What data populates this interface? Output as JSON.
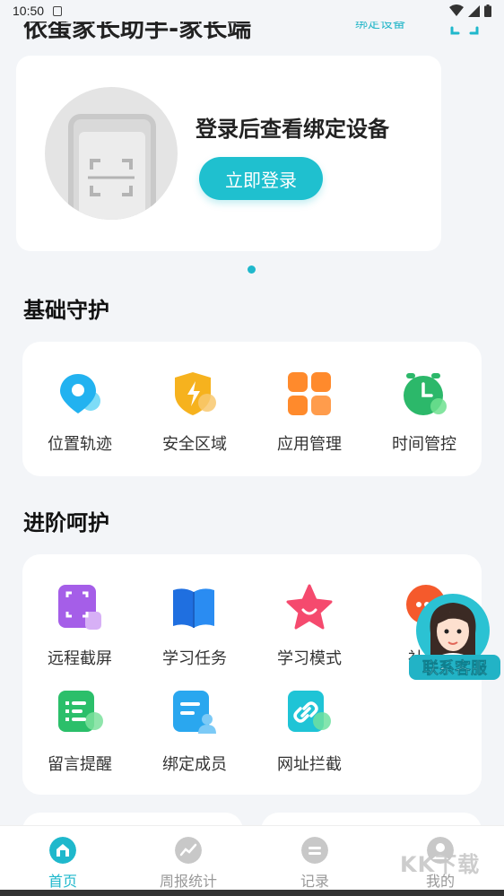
{
  "status": {
    "time": "10:50"
  },
  "header": {
    "title": "依蛋家长助手-家长端",
    "bind_device": "绑定设备"
  },
  "banner": {
    "headline": "登录后查看绑定设备",
    "login_button": "立即登录"
  },
  "basic": {
    "title": "基础守护",
    "items": [
      {
        "label": "位置轨迹",
        "icon": "location-icon"
      },
      {
        "label": "安全区域",
        "icon": "shield-icon"
      },
      {
        "label": "应用管理",
        "icon": "apps-icon"
      },
      {
        "label": "时间管控",
        "icon": "alarm-clock-icon"
      }
    ]
  },
  "advanced": {
    "title": "进阶呵护",
    "items": [
      {
        "label": "远程截屏",
        "icon": "screenshot-icon"
      },
      {
        "label": "学习任务",
        "icon": "book-icon"
      },
      {
        "label": "学习模式",
        "icon": "star-icon"
      },
      {
        "label": "社交",
        "icon": "chat-icon"
      },
      {
        "label": "留言提醒",
        "icon": "message-icon"
      },
      {
        "label": "绑定成员",
        "icon": "member-icon"
      },
      {
        "label": "网址拦截",
        "icon": "link-icon"
      }
    ]
  },
  "support": {
    "label": "联系客服"
  },
  "tabbar": {
    "tabs": [
      {
        "label": "首页",
        "active": true
      },
      {
        "label": "周报统计",
        "active": false
      },
      {
        "label": "记录",
        "active": false
      },
      {
        "label": "我的",
        "active": false
      }
    ]
  },
  "watermark": "KK下载",
  "colors": {
    "accent": "#1fc0cf",
    "background": "#f3f5f8"
  }
}
